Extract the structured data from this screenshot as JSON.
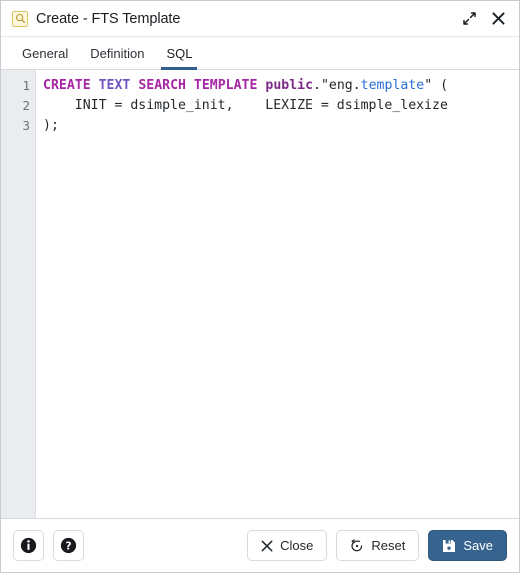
{
  "window": {
    "title": "Create - FTS Template",
    "title_icon": "fts-template-icon",
    "expand_icon": "expand-icon",
    "close_icon": "close-icon"
  },
  "tabs": [
    {
      "label": "General",
      "name": "tab-general",
      "active": false
    },
    {
      "label": "Definition",
      "name": "tab-definition",
      "active": false
    },
    {
      "label": "SQL",
      "name": "tab-sql",
      "active": true
    }
  ],
  "editor": {
    "line_numbers": [
      "1",
      "2",
      "3"
    ],
    "lines": [
      [
        {
          "t": "CREATE",
          "c": "k-magenta"
        },
        {
          "t": " ",
          "c": "k-plain"
        },
        {
          "t": "TEXT",
          "c": "k-violet"
        },
        {
          "t": " ",
          "c": "k-plain"
        },
        {
          "t": "SEARCH",
          "c": "k-magenta"
        },
        {
          "t": " ",
          "c": "k-plain"
        },
        {
          "t": "TEMPLATE",
          "c": "k-magenta"
        },
        {
          "t": " ",
          "c": "k-plain"
        },
        {
          "t": "public",
          "c": "k-schema"
        },
        {
          "t": ".\"eng.",
          "c": "k-plain"
        },
        {
          "t": "template",
          "c": "k-blue"
        },
        {
          "t": "\" (",
          "c": "k-plain"
        }
      ],
      [
        {
          "t": "    INIT = dsimple_init,    LEXIZE = dsimple_lexize",
          "c": "k-plain"
        }
      ],
      [
        {
          "t": ");",
          "c": "k-plain"
        }
      ]
    ],
    "plain_text": "CREATE TEXT SEARCH TEMPLATE public.\"eng.template\" (\n    INIT = dsimple_init,    LEXIZE = dsimple_lexize\n);"
  },
  "footer": {
    "info_icon": "info-icon",
    "help_icon": "help-icon",
    "close_label": "Close",
    "close_icon": "x-icon",
    "reset_label": "Reset",
    "reset_icon": "reset-icon",
    "save_label": "Save",
    "save_icon": "save-floppy-icon"
  },
  "colors": {
    "accent": "#36648f",
    "tab_underline": "#32608f",
    "keyword_magenta": "#a626a4",
    "keyword_violet": "#6f56c0",
    "schema_purple": "#7c2b88",
    "identifier_blue": "#2a6fd4",
    "gutter_bg": "#eaecf0"
  }
}
